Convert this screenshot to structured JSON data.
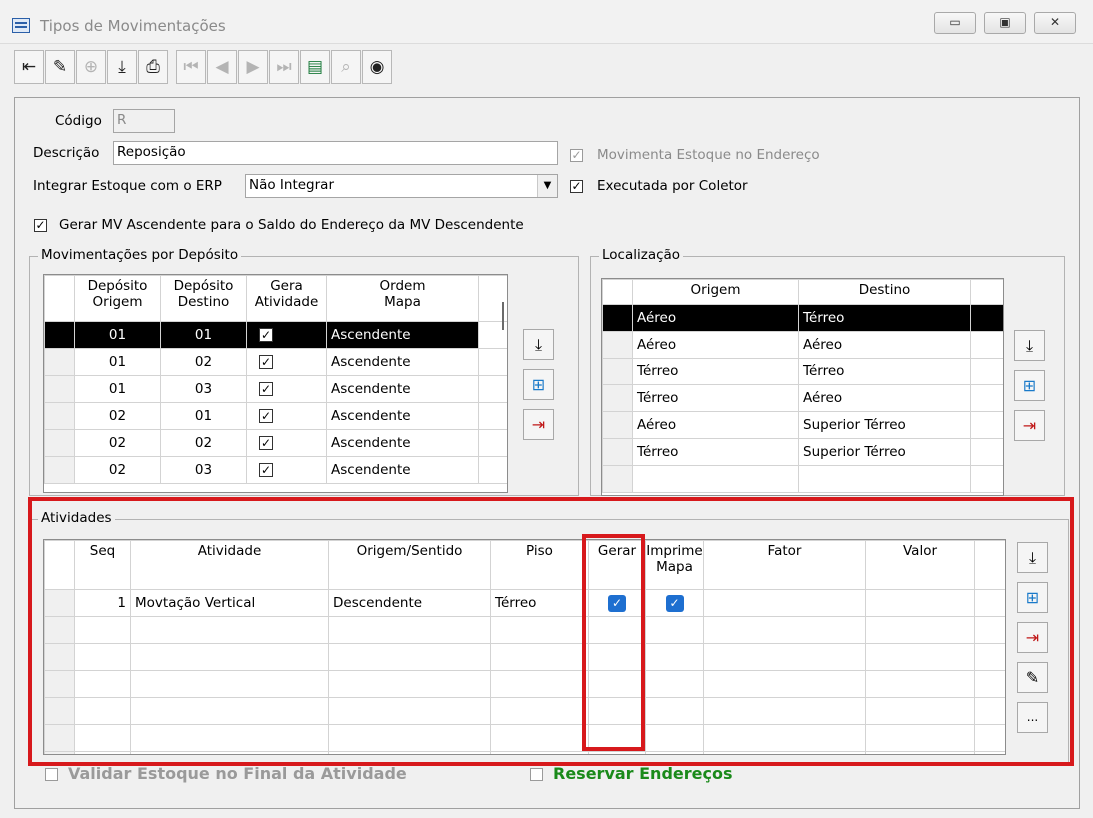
{
  "window": {
    "title": "Tipos de Movimentações",
    "controls": [
      "▭",
      "▣",
      "✕"
    ]
  },
  "toolbar": {
    "buttons": [
      {
        "icon": "exit-icon",
        "glyph": "⇤",
        "enabled": true
      },
      {
        "icon": "eraser-icon",
        "glyph": "✎",
        "enabled": true
      },
      {
        "icon": "add-record-icon",
        "glyph": "⊕",
        "enabled": false
      },
      {
        "icon": "save-icon",
        "glyph": "⤓",
        "enabled": true
      },
      {
        "icon": "print-icon",
        "glyph": "⎙",
        "enabled": true
      },
      {
        "icon": "first-record-icon",
        "glyph": "⏮",
        "enabled": false
      },
      {
        "icon": "prev-record-icon",
        "glyph": "◀",
        "enabled": false
      },
      {
        "icon": "next-record-icon",
        "glyph": "▶",
        "enabled": false
      },
      {
        "icon": "last-record-icon",
        "glyph": "⏭",
        "enabled": false
      },
      {
        "icon": "list-icon",
        "glyph": "▤",
        "enabled": true
      },
      {
        "icon": "binoculars-icon",
        "glyph": "⌕",
        "enabled": false
      },
      {
        "icon": "camera-icon",
        "glyph": "◉",
        "enabled": true
      }
    ]
  },
  "form": {
    "codigo_label": "Código",
    "codigo_value": "R",
    "descricao_label": "Descrição",
    "descricao_value": "Reposição",
    "integrar_label": "Integrar Estoque com o ERP",
    "integrar_value": "Não Integrar",
    "movimenta_label": "Movimenta Estoque no Endereço",
    "executada_label": "Executada por Coletor",
    "gerar_mv_label": "Gerar MV Ascendente para o Saldo do Endereço da MV Descendente",
    "check_glyph": "✓"
  },
  "deposito": {
    "title": "Movimentações por Depósito",
    "headers": [
      "Depósito\nOrigem",
      "Depósito\nDestino",
      "Gera\nAtividade",
      "Ordem\nMapa"
    ],
    "rows": [
      {
        "origem": "01",
        "destino": "01",
        "gera": true,
        "ordem": "Ascendente"
      },
      {
        "origem": "01",
        "destino": "02",
        "gera": true,
        "ordem": "Ascendente"
      },
      {
        "origem": "01",
        "destino": "03",
        "gera": true,
        "ordem": "Ascendente"
      },
      {
        "origem": "02",
        "destino": "01",
        "gera": true,
        "ordem": "Ascendente"
      },
      {
        "origem": "02",
        "destino": "02",
        "gera": true,
        "ordem": "Ascendente"
      },
      {
        "origem": "02",
        "destino": "03",
        "gera": true,
        "ordem": "Ascendente"
      }
    ]
  },
  "localizacao": {
    "title": "Localização",
    "headers": [
      "Origem",
      "Destino"
    ],
    "rows": [
      {
        "origem": "Aéreo",
        "destino": "Térreo"
      },
      {
        "origem": "Aéreo",
        "destino": "Aéreo"
      },
      {
        "origem": "Térreo",
        "destino": "Térreo"
      },
      {
        "origem": "Térreo",
        "destino": "Aéreo"
      },
      {
        "origem": "Aéreo",
        "destino": "Superior Térreo"
      },
      {
        "origem": "Térreo",
        "destino": "Superior Térreo"
      }
    ]
  },
  "atividades": {
    "title": "Atividades",
    "headers": [
      "Seq",
      "Atividade",
      "Origem/Sentido",
      "Piso",
      "Gerar",
      "Imprime\nMapa",
      "Fator",
      "Valor"
    ],
    "rows": [
      {
        "seq": "1",
        "atividade": "Movtação Vertical",
        "origem": "Descendente",
        "piso": "Térreo",
        "gerar": true,
        "imprime": true,
        "fator": "",
        "valor": ""
      }
    ],
    "empty_rows": 6,
    "more_button": "..."
  },
  "bottom": {
    "validar_label": "Validar Estoque no Final da Atividade",
    "reservar_label": "Reservar Endereços"
  },
  "side_buttons": {
    "insert": "⤓",
    "add": "⊞",
    "remove": "⇥",
    "clear": "✎"
  },
  "colors": {
    "highlight_red": "#d7191c",
    "checkbox_blue": "#1e6fd0",
    "selected_row": "#000000",
    "green_text": "#1a8a1a"
  }
}
